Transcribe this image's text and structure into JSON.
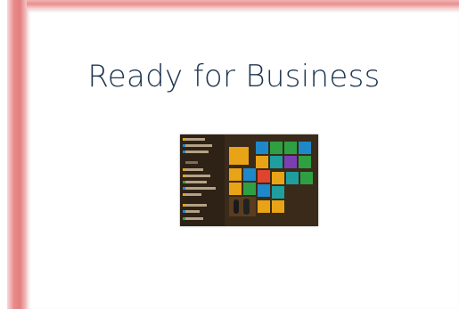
{
  "slide": {
    "title": "Ready for Business"
  },
  "thumbnail": {
    "colors": {
      "background": "#3a2a1a",
      "tile_orange": "#e8a317",
      "tile_blue": "#1e88c8",
      "tile_green": "#2ea043",
      "tile_purple": "#7a3fb0",
      "tile_teal": "#1f9e9e",
      "tile_dark": "#6b4a2a"
    }
  },
  "colors": {
    "accent_frame": "#e47e7e",
    "title_text": "#1d3550"
  }
}
